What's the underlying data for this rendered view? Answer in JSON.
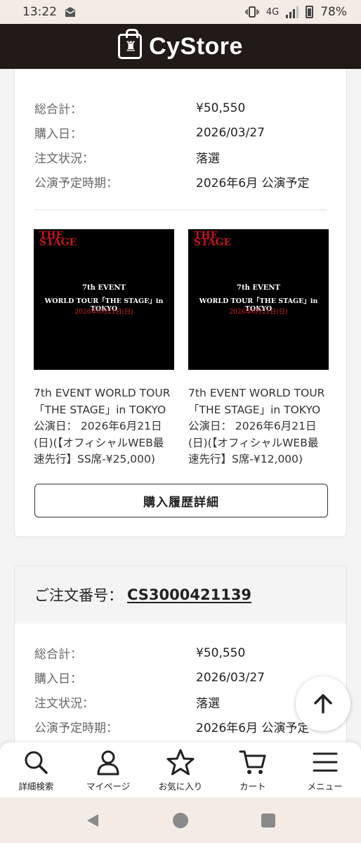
{
  "status_bar": {
    "time": "13:22",
    "network": "4G",
    "battery": "78%"
  },
  "header": {
    "brand": "CyStore"
  },
  "orders": [
    {
      "summary": [
        {
          "label": "総合計：",
          "value": "¥50,550"
        },
        {
          "label": "購入日：",
          "value": "2026/03/27"
        },
        {
          "label": "注文状況：",
          "value": "落選"
        },
        {
          "label": "公演予定時期：",
          "value": "2026年6月 公演予定"
        }
      ],
      "products": [
        {
          "thumb_logo_top": "THE",
          "thumb_logo_bottom": "STAGE",
          "thumb_line1": "7th EVENT",
          "thumb_line2": "WORLD TOUR「THE STAGE」in TOKYO",
          "thumb_line3": "2026年6月21日(日)",
          "description": "7th EVENT WORLD TOUR「THE STAGE」in TOKYO 公演日： 2026年6月21日(日)(【オフィシャルWEB最速先行】SS席-¥25,000)"
        },
        {
          "thumb_logo_top": "THE",
          "thumb_logo_bottom": "STAGE",
          "thumb_line1": "7th EVENT",
          "thumb_line2": "WORLD TOUR「THE STAGE」in TOKYO",
          "thumb_line3": "2026年6月21日(日)",
          "description": "7th EVENT WORLD TOUR「THE STAGE」in TOKYO 公演日： 2026年6月21日(日)(【オフィシャルWEB最速先行】S席-¥12,000)"
        }
      ],
      "detail_button": "購入履歴詳細"
    },
    {
      "order_label": "ご注文番号：",
      "order_number": "CS3000421139",
      "summary": [
        {
          "label": "総合計：",
          "value": "¥50,550"
        },
        {
          "label": "購入日：",
          "value": "2026/03/27"
        },
        {
          "label": "注文状況：",
          "value": "落選"
        },
        {
          "label": "公演予定時期：",
          "value": "2026年6月 公演予定"
        }
      ]
    }
  ],
  "bottom_nav": [
    {
      "label": "詳細検索",
      "icon": "search-icon"
    },
    {
      "label": "マイページ",
      "icon": "user-icon"
    },
    {
      "label": "お気に入り",
      "icon": "star-icon"
    },
    {
      "label": "カート",
      "icon": "cart-icon"
    },
    {
      "label": "メニュー",
      "icon": "menu-icon"
    }
  ],
  "colors": {
    "header_bg": "#211a17",
    "status_bg": "#f4ece4",
    "thumb_accent": "#c0161c"
  }
}
